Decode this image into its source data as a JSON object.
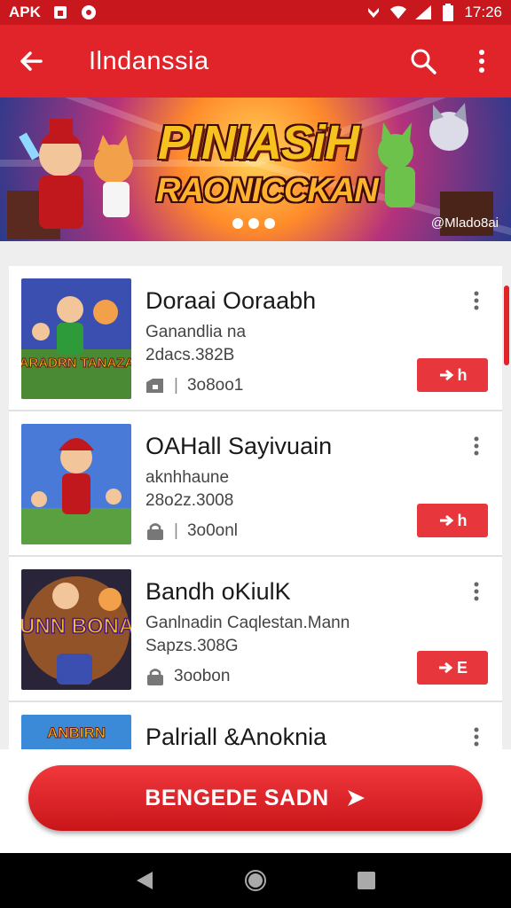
{
  "status_bar": {
    "left_label": "APK",
    "time": "17:26",
    "icons": [
      "apk-box-icon",
      "record-icon",
      "nfc-icon",
      "wifi-icon",
      "signal-icon",
      "battery-icon"
    ]
  },
  "app_bar": {
    "title": "Ilndanssia",
    "icons": [
      "back-arrow-icon",
      "search-icon",
      "more-vert-icon"
    ]
  },
  "banner": {
    "title": "PINIASiH",
    "subtitle": "RAONICCKAN",
    "credit": "@Mlado8ai",
    "dot_count": 3
  },
  "items": [
    {
      "title": "Doraai Ooraabh",
      "subtitle": "Ganandlia na",
      "size": "2dacs.382B",
      "count": "3o8oo1",
      "button_label": "h",
      "thumb_text": "BARADRN TANAZAS"
    },
    {
      "title": "OAHall Sayivuain",
      "subtitle": "aknhhaune",
      "size": "28o2z.3008",
      "count": "3o0onl",
      "button_label": "h",
      "thumb_text": ""
    },
    {
      "title": "Bandh oKiulK",
      "subtitle": "Ganlnadin  Caqlestan.Mann",
      "size": "Sapzs.308G",
      "count": "3oobon",
      "button_label": "E",
      "thumb_text": "DUNN BONAS"
    },
    {
      "title": "Palriall &Anoknia",
      "thumb_text": "ANBIRN"
    }
  ],
  "fab": {
    "label": "BENGEDE SADN"
  },
  "colors": {
    "primary": "#e0242a",
    "status_bar": "#c8171d",
    "button": "#e8373c"
  }
}
